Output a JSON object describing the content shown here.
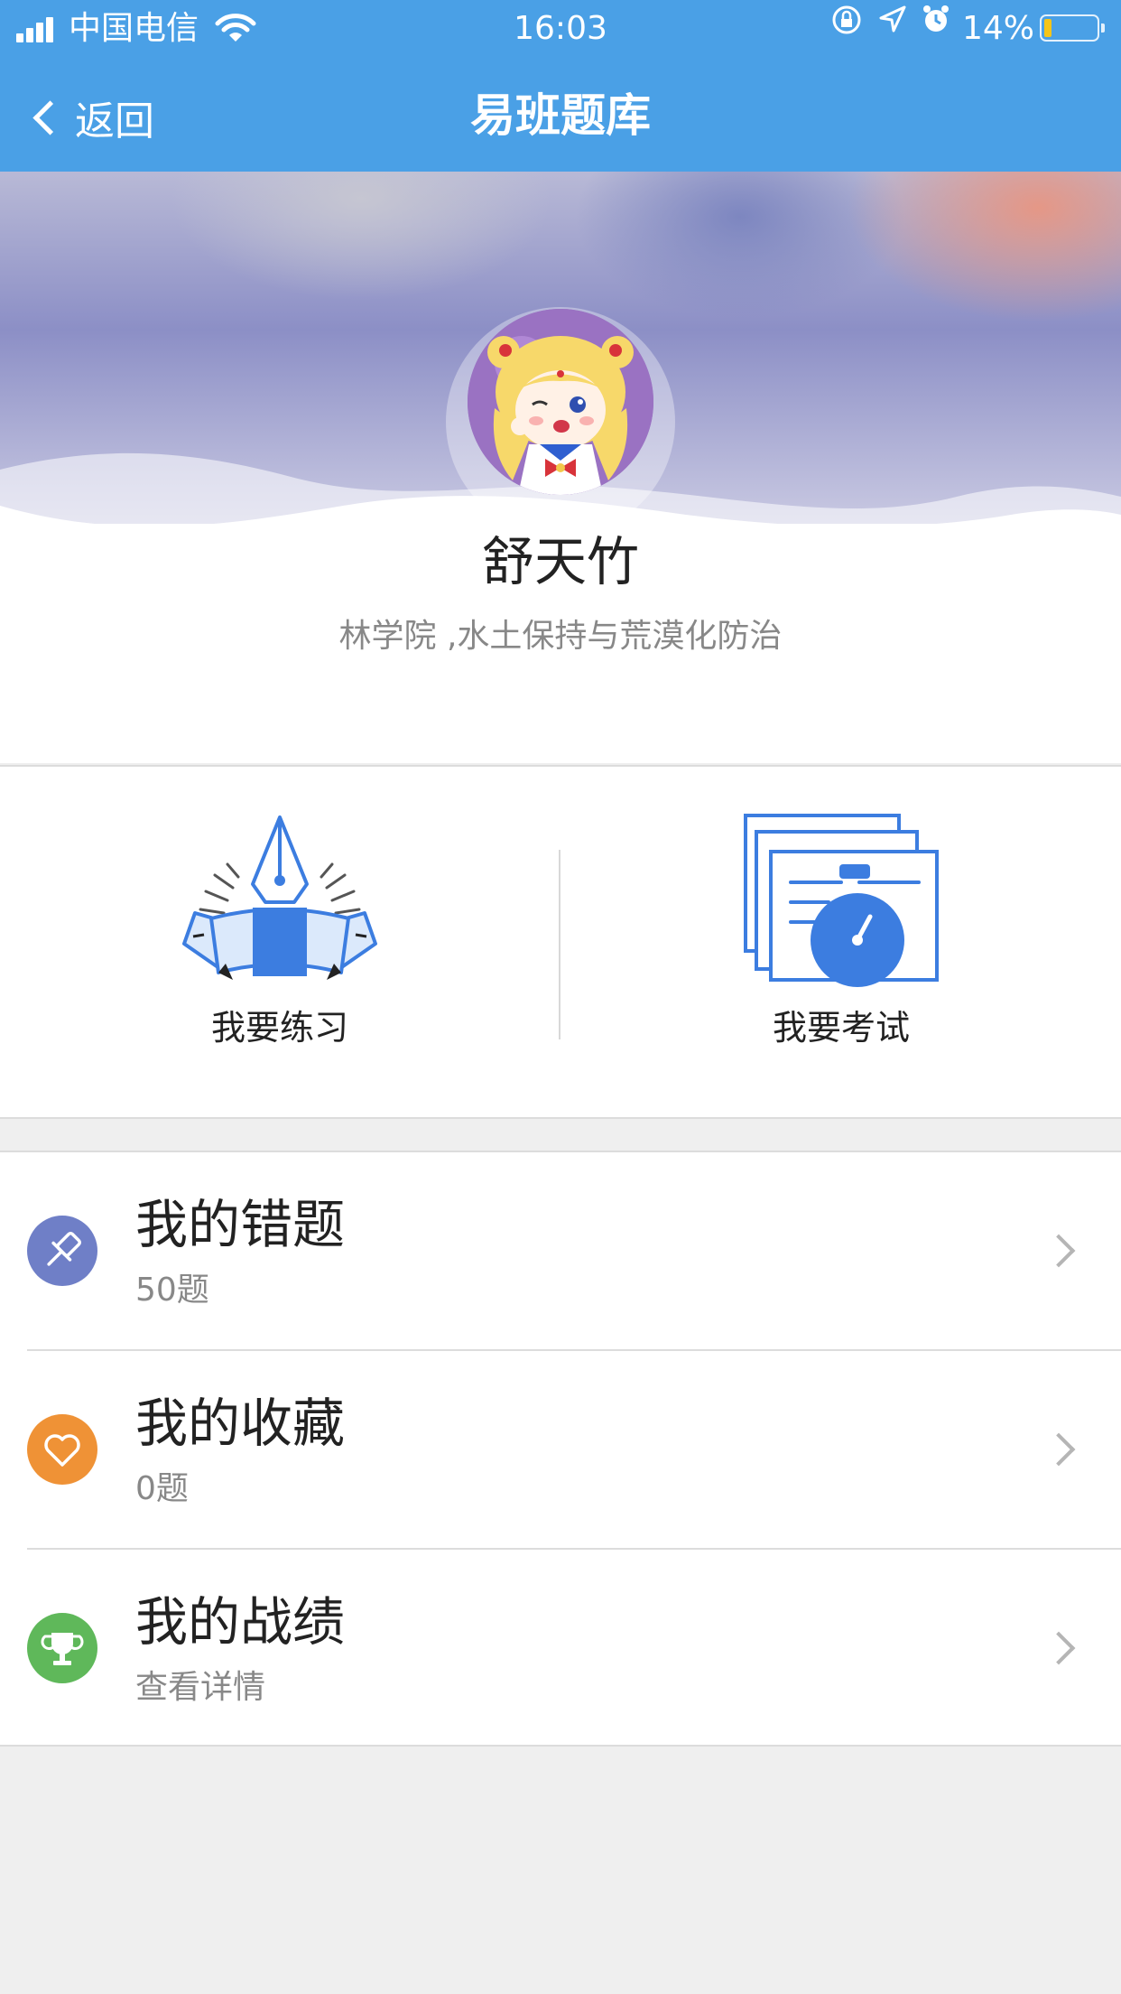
{
  "status_bar": {
    "carrier": "中国电信",
    "time": "16:03",
    "battery_percent": "14%",
    "battery_level": 0.14,
    "icons": [
      "signal-icon",
      "wifi-icon",
      "orientation-lock-icon",
      "location-icon",
      "alarm-icon",
      "battery-icon"
    ]
  },
  "nav": {
    "back_label": "返回",
    "title": "易班题库"
  },
  "profile": {
    "name": "舒天竹",
    "department": "林学院 ,水土保持与荒漠化防治"
  },
  "actions": [
    {
      "label": "我要练习",
      "icon": "fountain-pen-icon"
    },
    {
      "label": "我要考试",
      "icon": "stopwatch-documents-icon"
    }
  ],
  "list": [
    {
      "title": "我的错题",
      "subtitle": "50题",
      "icon": "pin-icon",
      "color": "#6f7fc7"
    },
    {
      "title": "我的收藏",
      "subtitle": "0题",
      "icon": "heart-icon",
      "color": "#ef9236"
    },
    {
      "title": "我的战绩",
      "subtitle": "查看详情",
      "icon": "trophy-icon",
      "color": "#5fb85a"
    }
  ],
  "colors": {
    "nav_blue": "#4aa0e6",
    "icon_blue": "#3c7de0",
    "background": "#efefef"
  }
}
